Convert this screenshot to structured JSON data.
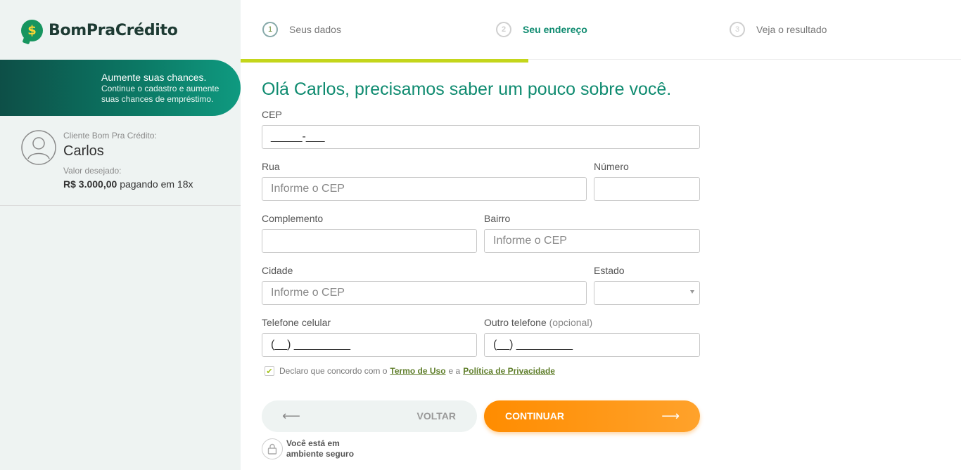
{
  "brand": {
    "name": "BomPraCrédito",
    "symbol": "$"
  },
  "sidebar": {
    "chances_title": "Aumente suas chances.",
    "chances_sub": "Continue o cadastro e aumente suas chances de empréstimo.",
    "client_label": "Cliente Bom Pra Crédito:",
    "client_name": "Carlos",
    "value_label": "Valor desejado:",
    "value_amount": "R$ 3.000,00",
    "value_terms": "pagando em 18x"
  },
  "steps": [
    {
      "label": "Seus dados",
      "number": "1",
      "state": "done"
    },
    {
      "label": "Seu endereço",
      "number": "2",
      "state": "active"
    },
    {
      "label": "Veja o resultado",
      "number": "3",
      "state": "pending"
    }
  ],
  "form": {
    "heading": "Olá Carlos, precisamos saber um pouco sobre você.",
    "cep": {
      "label": "CEP",
      "value": "_____-___"
    },
    "rua": {
      "label": "Rua",
      "placeholder": "Informe o CEP"
    },
    "numero": {
      "label": "Número",
      "value": ""
    },
    "complemento": {
      "label": "Complemento",
      "value": ""
    },
    "bairro": {
      "label": "Bairro",
      "placeholder": "Informe o CEP"
    },
    "cidade": {
      "label": "Cidade",
      "placeholder": "Informe o CEP"
    },
    "estado": {
      "label": "Estado",
      "value": ""
    },
    "celular": {
      "label": "Telefone celular",
      "value": "(__) _________"
    },
    "outro": {
      "label": "Outro telefone",
      "optional": "(opcional)",
      "value": "(__) _________"
    },
    "terms": {
      "prefix": "Declaro que concordo com o",
      "terms_link": "Termo de Uso",
      "middle": "e a",
      "privacy_link": "Política de Privacidade",
      "checked": true
    },
    "back_label": "VOLTAR",
    "continue_label": "CONTINUAR",
    "secure_text": "Você está em ambiente seguro"
  },
  "colors": {
    "accent": "#0f8b70",
    "progress": "#c4d61b",
    "cta": "#ff8c00"
  }
}
